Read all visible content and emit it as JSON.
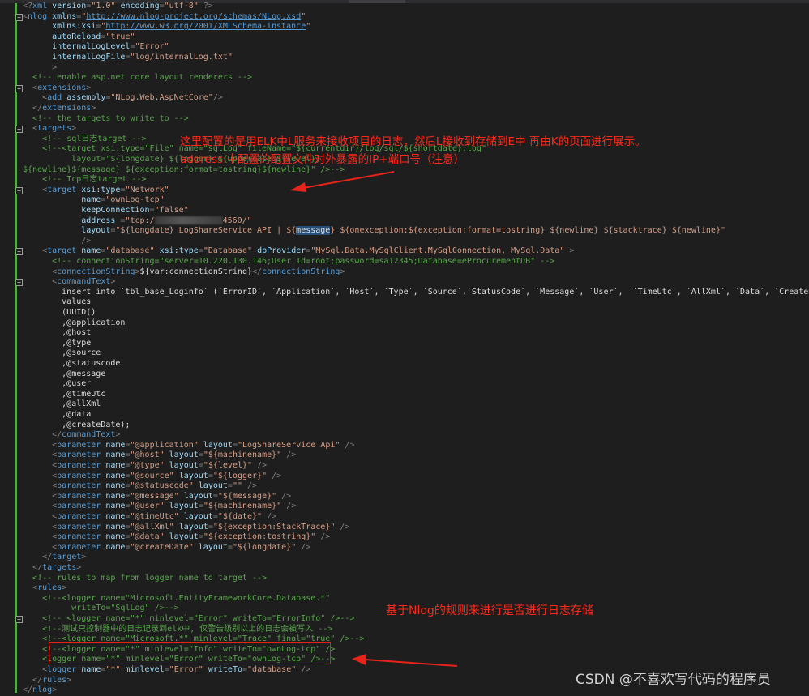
{
  "colors": {
    "background": "#1e1e1e",
    "tag": "#569cd6",
    "attribute": "#9cdcfe",
    "string": "#d69d85",
    "text": "#dcdcdc",
    "comment": "#57a64a",
    "punctuation": "#808080",
    "annotation": "#ff2a1a"
  },
  "editor": {
    "lines": [
      [
        [
          "p",
          "<?"
        ],
        [
          "g",
          "xml"
        ],
        [
          "a",
          " version"
        ],
        [
          "p",
          "="
        ],
        [
          "s",
          "\"1.0\""
        ],
        [
          "a",
          " encoding"
        ],
        [
          "p",
          "="
        ],
        [
          "s",
          "\"utf-8\""
        ],
        [
          "p",
          " ?>"
        ]
      ],
      [
        [
          "p",
          "<"
        ],
        [
          "g",
          "nlog"
        ],
        [
          "a",
          " xmlns"
        ],
        [
          "p",
          "="
        ],
        [
          "s",
          "\""
        ],
        [
          "u",
          "http://www.nlog-project.org/schemas/NLog.xsd"
        ],
        [
          "s",
          "\""
        ]
      ],
      [
        [
          "t",
          "      "
        ],
        [
          "a",
          "xmlns:xsi"
        ],
        [
          "p",
          "="
        ],
        [
          "s",
          "\""
        ],
        [
          "u",
          "http://www.w3.org/2001/XMLSchema-instance"
        ],
        [
          "s",
          "\""
        ]
      ],
      [
        [
          "t",
          "      "
        ],
        [
          "a",
          "autoReload"
        ],
        [
          "p",
          "="
        ],
        [
          "s",
          "\"true\""
        ]
      ],
      [
        [
          "t",
          "      "
        ],
        [
          "a",
          "internalLogLevel"
        ],
        [
          "p",
          "="
        ],
        [
          "s",
          "\"Error\""
        ]
      ],
      [
        [
          "t",
          "      "
        ],
        [
          "a",
          "internalLogFile"
        ],
        [
          "p",
          "="
        ],
        [
          "s",
          "\"log/internalLog.txt\""
        ]
      ],
      [
        [
          "t",
          "      "
        ],
        [
          "p",
          ">"
        ]
      ],
      [
        [
          "t",
          "  "
        ],
        [
          "c",
          "<!-- enable asp.net core layout renderers -->"
        ]
      ],
      [
        [
          "t",
          "  "
        ],
        [
          "p",
          "<"
        ],
        [
          "g",
          "extensions"
        ],
        [
          "p",
          ">"
        ]
      ],
      [
        [
          "t",
          "    "
        ],
        [
          "p",
          "<"
        ],
        [
          "g",
          "add"
        ],
        [
          "a",
          " assembly"
        ],
        [
          "p",
          "="
        ],
        [
          "s",
          "\"NLog.Web.AspNetCore\""
        ],
        [
          "p",
          "/>"
        ]
      ],
      [
        [
          "t",
          "  "
        ],
        [
          "p",
          "</"
        ],
        [
          "g",
          "extensions"
        ],
        [
          "p",
          ">"
        ]
      ],
      [
        [
          "t",
          "  "
        ],
        [
          "c",
          "<!-- the targets to write to -->"
        ]
      ],
      [
        [
          "t",
          "  "
        ],
        [
          "p",
          "<"
        ],
        [
          "g",
          "targets"
        ],
        [
          "p",
          ">"
        ]
      ],
      [
        [
          "t",
          "    "
        ],
        [
          "c",
          "<!-- sql日志target -->"
        ]
      ],
      [
        [
          "t",
          "    "
        ],
        [
          "c",
          "<!--<target xsi:type=\"File\" name=\"sqlLog\" fileName=\"${currentdir}/log/sql/${shortdate}.log\""
        ]
      ],
      [
        [
          "t",
          "          "
        ],
        [
          "c",
          "layout=\"${longdate} ${logger} ${uppercase:${level}}"
        ]
      ],
      [
        [
          "c",
          "${newline}${message} ${exception:format=tostring}${newline}\" />-->"
        ]
      ],
      [
        [
          "t",
          "    "
        ],
        [
          "c",
          "<!-- Tcp日志target -->"
        ]
      ],
      [
        [
          "t",
          "    "
        ],
        [
          "p",
          "<"
        ],
        [
          "g",
          "target"
        ],
        [
          "a",
          " xsi:type"
        ],
        [
          "p",
          "="
        ],
        [
          "s",
          "\"Network\""
        ]
      ],
      [
        [
          "t",
          "            "
        ],
        [
          "a",
          "name"
        ],
        [
          "p",
          "="
        ],
        [
          "s",
          "\"ownLog-tcp\""
        ]
      ],
      [
        [
          "t",
          "            "
        ],
        [
          "a",
          "keepConnection"
        ],
        [
          "p",
          "="
        ],
        [
          "s",
          "\"false\""
        ]
      ],
      [
        [
          "t",
          "            "
        ],
        [
          "a",
          "address"
        ],
        [
          "p",
          " ="
        ],
        [
          "s",
          "\"tcp:/"
        ],
        [
          "x",
          ""
        ],
        [
          "s",
          "4560/\""
        ]
      ],
      [
        [
          "t",
          "            "
        ],
        [
          "a",
          "layout"
        ],
        [
          "p",
          "="
        ],
        [
          "s",
          "\"${longdate} LogShareService API | ${"
        ],
        [
          "h",
          "message"
        ],
        [
          "s",
          "} ${onexception:${exception:format=tostring} ${newline} ${stacktrace} ${newline}\""
        ]
      ],
      [
        [
          "t",
          "            "
        ],
        [
          "p",
          "/>"
        ]
      ],
      [
        [
          "t",
          "    "
        ],
        [
          "p",
          "<"
        ],
        [
          "g",
          "target"
        ],
        [
          "a",
          " name"
        ],
        [
          "p",
          "="
        ],
        [
          "s",
          "\"database\""
        ],
        [
          "a",
          " xsi:type"
        ],
        [
          "p",
          "="
        ],
        [
          "s",
          "\"Database\""
        ],
        [
          "a",
          " dbProvider"
        ],
        [
          "p",
          "="
        ],
        [
          "s",
          "\"MySql.Data.MySqlClient.MySqlConnection, MySql.Data\""
        ],
        [
          "p",
          " >"
        ]
      ],
      [
        [
          "t",
          "      "
        ],
        [
          "c",
          "<!-- connectionString=\"server=10.220.130.146;User Id=root;password=sa12345;Database=eProcurementDB\" -->"
        ]
      ],
      [
        [
          "t",
          "      "
        ],
        [
          "p",
          "<"
        ],
        [
          "g",
          "connectionString"
        ],
        [
          "p",
          ">"
        ],
        [
          "t",
          "${var:connectionString}"
        ],
        [
          "p",
          "</"
        ],
        [
          "g",
          "connectionString"
        ],
        [
          "p",
          ">"
        ]
      ],
      [
        [
          "t",
          "      "
        ],
        [
          "p",
          "<"
        ],
        [
          "g",
          "commandText"
        ],
        [
          "p",
          ">"
        ]
      ],
      [
        [
          "t",
          "        insert into `tbl_base_Loginfo` (`ErrorID`, `Application`, `Host`, `Type`, `Source`,`StatusCode`, `Message`, `User`,  `TimeUtc`, `AllXml`, `Data`, `CreateDate`)"
        ]
      ],
      [
        [
          "t",
          "        values"
        ]
      ],
      [
        [
          "t",
          "        (UUID()"
        ]
      ],
      [
        [
          "t",
          "        ,@application"
        ]
      ],
      [
        [
          "t",
          "        ,@host"
        ]
      ],
      [
        [
          "t",
          "        ,@type"
        ]
      ],
      [
        [
          "t",
          "        ,@source"
        ]
      ],
      [
        [
          "t",
          "        ,@statuscode"
        ]
      ],
      [
        [
          "t",
          "        ,@message"
        ]
      ],
      [
        [
          "t",
          "        ,@user"
        ]
      ],
      [
        [
          "t",
          "        ,@timeUtc"
        ]
      ],
      [
        [
          "t",
          "        ,@allXml"
        ]
      ],
      [
        [
          "t",
          "        ,@data"
        ]
      ],
      [
        [
          "t",
          "        ,@createDate);"
        ]
      ],
      [
        [
          "t",
          "      "
        ],
        [
          "p",
          "</"
        ],
        [
          "g",
          "commandText"
        ],
        [
          "p",
          ">"
        ]
      ],
      [
        [
          "t",
          "      "
        ],
        [
          "p",
          "<"
        ],
        [
          "g",
          "parameter"
        ],
        [
          "a",
          " name"
        ],
        [
          "p",
          "="
        ],
        [
          "s",
          "\"@application\""
        ],
        [
          "a",
          " layout"
        ],
        [
          "p",
          "="
        ],
        [
          "s",
          "\"LogShareService Api\""
        ],
        [
          "p",
          " />"
        ]
      ],
      [
        [
          "t",
          "      "
        ],
        [
          "p",
          "<"
        ],
        [
          "g",
          "parameter"
        ],
        [
          "a",
          " name"
        ],
        [
          "p",
          "="
        ],
        [
          "s",
          "\"@host\""
        ],
        [
          "a",
          " layout"
        ],
        [
          "p",
          "="
        ],
        [
          "s",
          "\"${machinename}\""
        ],
        [
          "p",
          " />"
        ]
      ],
      [
        [
          "t",
          "      "
        ],
        [
          "p",
          "<"
        ],
        [
          "g",
          "parameter"
        ],
        [
          "a",
          " name"
        ],
        [
          "p",
          "="
        ],
        [
          "s",
          "\"@type\""
        ],
        [
          "a",
          " layout"
        ],
        [
          "p",
          "="
        ],
        [
          "s",
          "\"${level}\""
        ],
        [
          "p",
          " />"
        ]
      ],
      [
        [
          "t",
          "      "
        ],
        [
          "p",
          "<"
        ],
        [
          "g",
          "parameter"
        ],
        [
          "a",
          " name"
        ],
        [
          "p",
          "="
        ],
        [
          "s",
          "\"@source\""
        ],
        [
          "a",
          " layout"
        ],
        [
          "p",
          "="
        ],
        [
          "s",
          "\"${logger}\""
        ],
        [
          "p",
          " />"
        ]
      ],
      [
        [
          "t",
          "      "
        ],
        [
          "p",
          "<"
        ],
        [
          "g",
          "parameter"
        ],
        [
          "a",
          " name"
        ],
        [
          "p",
          "="
        ],
        [
          "s",
          "\"@statuscode\""
        ],
        [
          "a",
          " layout"
        ],
        [
          "p",
          "="
        ],
        [
          "s",
          "\"\""
        ],
        [
          "p",
          " />"
        ]
      ],
      [
        [
          "t",
          "      "
        ],
        [
          "p",
          "<"
        ],
        [
          "g",
          "parameter"
        ],
        [
          "a",
          " name"
        ],
        [
          "p",
          "="
        ],
        [
          "s",
          "\"@message\""
        ],
        [
          "a",
          " layout"
        ],
        [
          "p",
          "="
        ],
        [
          "s",
          "\"${message}\""
        ],
        [
          "p",
          " />"
        ]
      ],
      [
        [
          "t",
          "      "
        ],
        [
          "p",
          "<"
        ],
        [
          "g",
          "parameter"
        ],
        [
          "a",
          " name"
        ],
        [
          "p",
          "="
        ],
        [
          "s",
          "\"@user\""
        ],
        [
          "a",
          " layout"
        ],
        [
          "p",
          "="
        ],
        [
          "s",
          "\"${machinename}\""
        ],
        [
          "p",
          " />"
        ]
      ],
      [
        [
          "t",
          "      "
        ],
        [
          "p",
          "<"
        ],
        [
          "g",
          "parameter"
        ],
        [
          "a",
          " name"
        ],
        [
          "p",
          "="
        ],
        [
          "s",
          "\"@timeUtc\""
        ],
        [
          "a",
          " layout"
        ],
        [
          "p",
          "="
        ],
        [
          "s",
          "\"${date}\""
        ],
        [
          "p",
          " />"
        ]
      ],
      [
        [
          "t",
          "      "
        ],
        [
          "p",
          "<"
        ],
        [
          "g",
          "parameter"
        ],
        [
          "a",
          " name"
        ],
        [
          "p",
          "="
        ],
        [
          "s",
          "\"@allXml\""
        ],
        [
          "a",
          " layout"
        ],
        [
          "p",
          "="
        ],
        [
          "s",
          "\"${exception:StackTrace}\""
        ],
        [
          "p",
          " />"
        ]
      ],
      [
        [
          "t",
          "      "
        ],
        [
          "p",
          "<"
        ],
        [
          "g",
          "parameter"
        ],
        [
          "a",
          " name"
        ],
        [
          "p",
          "="
        ],
        [
          "s",
          "\"@data\""
        ],
        [
          "a",
          " layout"
        ],
        [
          "p",
          "="
        ],
        [
          "s",
          "\"${exception:tostring}\""
        ],
        [
          "p",
          " />"
        ]
      ],
      [
        [
          "t",
          "      "
        ],
        [
          "p",
          "<"
        ],
        [
          "g",
          "parameter"
        ],
        [
          "a",
          " name"
        ],
        [
          "p",
          "="
        ],
        [
          "s",
          "\"@createDate\""
        ],
        [
          "a",
          " layout"
        ],
        [
          "p",
          "="
        ],
        [
          "s",
          "\"${longdate}\""
        ],
        [
          "p",
          " />"
        ]
      ],
      [
        [
          "t",
          "    "
        ],
        [
          "p",
          "</"
        ],
        [
          "g",
          "target"
        ],
        [
          "p",
          ">"
        ]
      ],
      [
        [
          "t",
          "  "
        ],
        [
          "p",
          "</"
        ],
        [
          "g",
          "targets"
        ],
        [
          "p",
          ">"
        ]
      ],
      [
        [
          "t",
          "  "
        ],
        [
          "c",
          "<!-- rules to map from logger name to target -->"
        ]
      ],
      [
        [
          "t",
          "  "
        ],
        [
          "p",
          "<"
        ],
        [
          "g",
          "rules"
        ],
        [
          "p",
          ">"
        ]
      ],
      [
        [
          "t",
          "    "
        ],
        [
          "c",
          "<!--<logger name=\"Microsoft.EntityFrameworkCore.Database.*\""
        ]
      ],
      [
        [
          "t",
          "          "
        ],
        [
          "c",
          "writeTo=\"SqlLog\" />-->"
        ]
      ],
      [
        [
          "t",
          "    "
        ],
        [
          "c",
          "<!-- <logger name=\"*\" minlevel=\"Error\" writeTo=\"ErrorInfo\" />-->"
        ]
      ],
      [
        [
          "t",
          "    "
        ],
        [
          "c",
          "<!--测试只控制器中的日志记录到elk中, 仅警告级别以上的日志会被写入 -->"
        ]
      ],
      [
        [
          "t",
          "    "
        ],
        [
          "c",
          "<!--<logger name=\"Microsoft.*\" minlevel=\"Trace\" final=\"true\" />-->"
        ]
      ],
      [
        [
          "t",
          "    "
        ],
        [
          "c",
          "<!--<logger name=\"*\" minlevel=\"Info\" writeTo=\"ownLog-tcp\" />"
        ]
      ],
      [
        [
          "t",
          "    "
        ],
        [
          "c",
          "<logger name=\"*\" minlevel=\"Error\" writeTo=\"ownLog-tcp\" />-->"
        ]
      ],
      [
        [
          "t",
          "    "
        ],
        [
          "p",
          "<"
        ],
        [
          "g",
          "logger"
        ],
        [
          "a",
          " name"
        ],
        [
          "p",
          "="
        ],
        [
          "s",
          "\"*\""
        ],
        [
          "a",
          " minlevel"
        ],
        [
          "p",
          "="
        ],
        [
          "s",
          "\"Error\""
        ],
        [
          "a",
          " writeTo"
        ],
        [
          "p",
          "="
        ],
        [
          "s",
          "\"database\""
        ],
        [
          "p",
          " />"
        ]
      ],
      [
        [
          "t",
          "  "
        ],
        [
          "p",
          "</"
        ],
        [
          "g",
          "rules"
        ],
        [
          "p",
          ">"
        ]
      ],
      [
        [
          "p",
          "</"
        ],
        [
          "g",
          "nlog"
        ],
        [
          "p",
          ">"
        ]
      ]
    ]
  },
  "annotations": {
    "note1": "这里配置的是用ELK中L服务来接收项目的日志，然后L接收到存储到E中 再由K的页面进行展示。",
    "note2": "address:中配置的配置文件对外暴露的IP+端口号（注意）",
    "note3": "基于Nlog的规则来进行是否进行日志存储"
  },
  "watermark": "CSDN @不喜欢写代码的程序员"
}
